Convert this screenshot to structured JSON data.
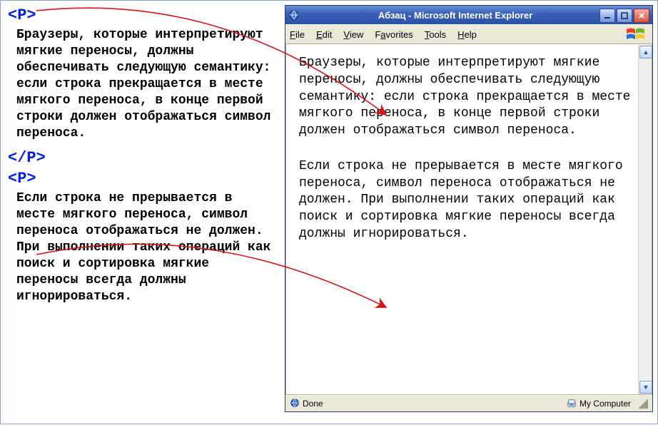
{
  "code": {
    "p_open": "<P>",
    "p_close": "</P>",
    "para1": "Браузеры, которые интерпретируют мягкие переносы, должны обеспечивать следующую семантику: если строка прекращается в месте мягкого переноса, в конце первой строки должен отображаться символ переноса.",
    "para2": "Если строка не прерывается в месте мягкого переноса, символ переноса отображаться не должен. При выполнении таких операций как поиск и сортировка мягкие переносы всегда должны игнорироваться."
  },
  "ie": {
    "title": "Абзац - Microsoft Internet Explorer",
    "menus": {
      "file": "File",
      "edit": "Edit",
      "view": "View",
      "fav": "Favorites",
      "tools": "Tools",
      "help": "Help"
    },
    "para1": "Браузеры, которые интерпретируют мягкие переносы, должны обеспечивать следующую семантику: если строка прекращается в месте мягкого переноса, в конце первой строки должен отображаться символ переноса.",
    "para2": "Если строка не прерывается в месте мягкого переноса, символ переноса отображаться не должен. При выполнении таких операций как поиск и сортировка мягкие переносы всегда должны игнорироваться.",
    "status_left": "Done",
    "status_right": "My Computer"
  }
}
